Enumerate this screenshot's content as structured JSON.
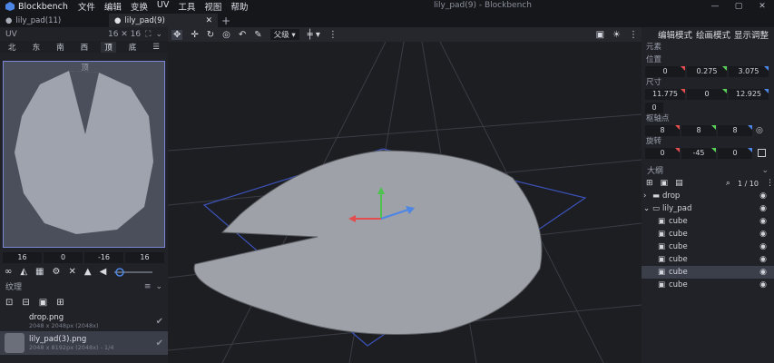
{
  "app": {
    "name": "Blockbench",
    "window_title": "lily_pad(9) - Blockbench"
  },
  "menu": [
    "文件",
    "编辑",
    "变换",
    "UV",
    "工具",
    "视图",
    "帮助"
  ],
  "window_controls": [
    "—",
    "▢",
    "✕"
  ],
  "tabs": [
    {
      "label": "lily_pad(11)",
      "active": false
    },
    {
      "label": "lily_pad(9)",
      "active": true
    }
  ],
  "uv": {
    "panel_label": "UV",
    "resolution": "16 ✕ 16",
    "faces": [
      "北",
      "东",
      "南",
      "西",
      "顶",
      "底"
    ],
    "active_face": "顶",
    "face_label": "顶",
    "values": [
      "16",
      "0",
      "-16",
      "16"
    ],
    "tools": [
      "link-icon",
      "fill-icon",
      "grid-icon",
      "gear-icon",
      "x-icon",
      "triangle-icon",
      "volume-icon"
    ]
  },
  "textures": {
    "panel_label": "纹理",
    "items": [
      {
        "name": "drop.png",
        "info": "2048 x 2048px (2048x)",
        "selected": false
      },
      {
        "name": "lily_pad(3).png",
        "info": "2048 x 8192px (2048x) - 1/4",
        "selected": true
      }
    ]
  },
  "viewport": {
    "pivot_mode": "父级",
    "accent": "#7a86d6"
  },
  "right": {
    "modes": [
      "编辑模式",
      "绘画模式",
      "显示调整"
    ],
    "element_label": "元素",
    "position_label": "位置",
    "position": [
      "0",
      "0.275",
      "3.075"
    ],
    "size_label": "尺寸",
    "size": [
      "11.775",
      "0",
      "12.925"
    ],
    "inflate": "0",
    "pivot_label": "枢轴点",
    "pivot": [
      "8",
      "8",
      "8"
    ],
    "rotation_label": "旋转",
    "rotation": [
      "0",
      "-45",
      "0"
    ],
    "outliner_label": "大纲",
    "page": "1 / 10",
    "tree": [
      {
        "label": "drop",
        "kind": "folder",
        "open": false,
        "depth": 0,
        "selected": false
      },
      {
        "label": "lily_pad",
        "kind": "folder",
        "open": true,
        "depth": 0,
        "selected": false
      },
      {
        "label": "cube",
        "kind": "cube",
        "depth": 1,
        "selected": false
      },
      {
        "label": "cube",
        "kind": "cube",
        "depth": 1,
        "selected": false
      },
      {
        "label": "cube",
        "kind": "cube",
        "depth": 1,
        "selected": false
      },
      {
        "label": "cube",
        "kind": "cube",
        "depth": 1,
        "selected": false
      },
      {
        "label": "cube",
        "kind": "cube",
        "depth": 1,
        "selected": true
      },
      {
        "label": "cube",
        "kind": "cube",
        "depth": 1,
        "selected": false
      }
    ]
  }
}
